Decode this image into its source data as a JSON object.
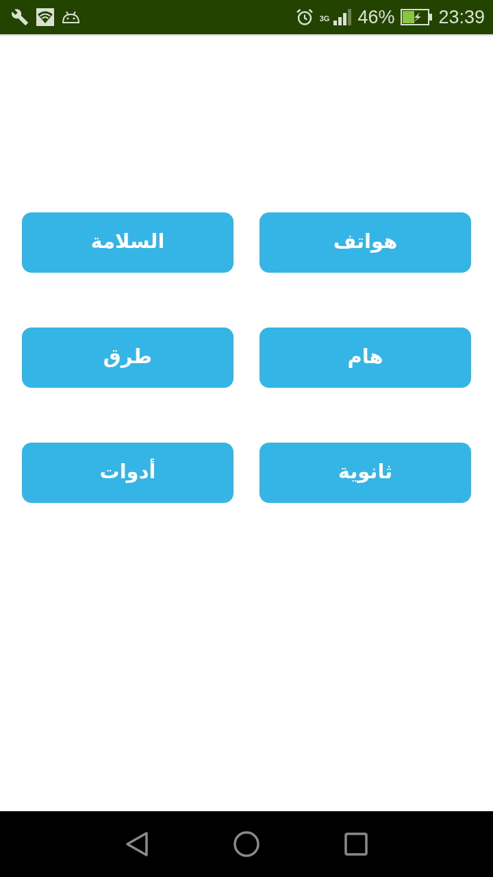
{
  "status_bar": {
    "network": "3G",
    "battery": "46%",
    "time": "23:39"
  },
  "buttons": [
    {
      "label": "هواتف"
    },
    {
      "label": "السلامة"
    },
    {
      "label": "هام"
    },
    {
      "label": "طرق"
    },
    {
      "label": "ثانوية"
    },
    {
      "label": "أدوات"
    }
  ]
}
